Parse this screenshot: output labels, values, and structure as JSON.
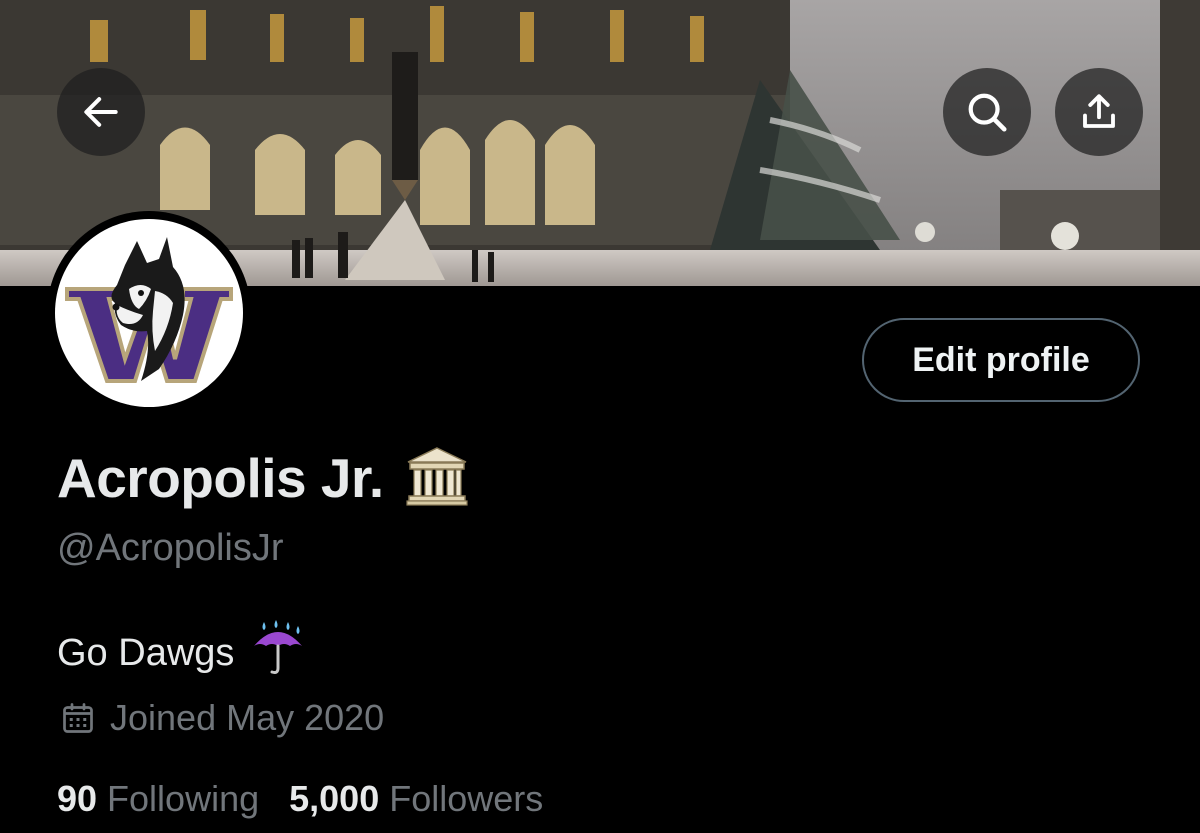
{
  "header": {
    "banner_icon": "university-building-snow-photo",
    "back_icon": "arrow-left-icon",
    "search_icon": "search-icon",
    "share_icon": "share-icon"
  },
  "profile": {
    "avatar_icon": "husky-w-logo",
    "display_name": "Acropolis Jr.",
    "name_emoji": "classical-building-emoji",
    "handle": "@AcropolisJr",
    "bio_text": "Go Dawgs",
    "bio_emoji": "umbrella-with-rain-emoji",
    "joined": "Joined May 2020",
    "following_count": "90",
    "following_label": "Following",
    "followers_count": "5,000",
    "followers_label": "Followers"
  },
  "actions": {
    "edit_profile_label": "Edit profile"
  },
  "colors": {
    "background": "#000000",
    "primary_text": "#e7e9ea",
    "secondary_text": "#71767b",
    "button_border": "#536471",
    "uw_purple": "#4b2e83",
    "uw_gold": "#b7a57a"
  }
}
